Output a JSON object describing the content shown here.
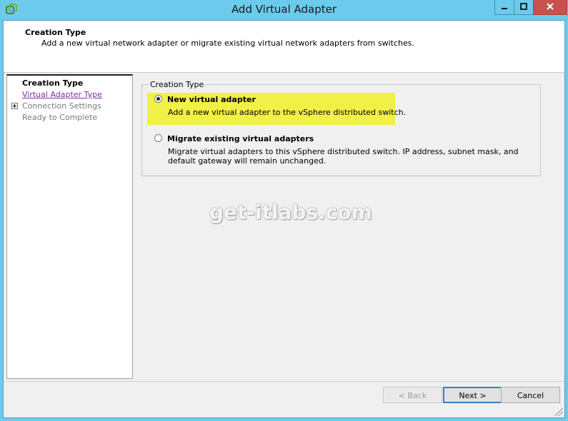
{
  "window": {
    "title": "Add Virtual Adapter",
    "minimize_glyph": "▬",
    "maximize_glyph": "▢",
    "close_glyph": "✕"
  },
  "header": {
    "title": "Creation Type",
    "description": "Add a new virtual network adapter or migrate existing virtual network adapters from switches."
  },
  "nav": {
    "items": [
      {
        "label": "Creation Type",
        "state": "current"
      },
      {
        "label": "Virtual Adapter Type",
        "state": "link"
      },
      {
        "label": "Connection Settings",
        "state": "disabled",
        "expandable": true
      },
      {
        "label": "Ready to Complete",
        "state": "disabled"
      }
    ]
  },
  "creation_type": {
    "group_label": "Creation Type",
    "options": [
      {
        "label": "New virtual adapter",
        "description": "Add a new virtual adapter to the vSphere distributed switch.",
        "selected": true
      },
      {
        "label": "Migrate existing virtual adapters",
        "description": "Migrate virtual adapters to this vSphere distributed switch. IP address, subnet mask, and default gateway will remain unchanged.",
        "selected": false
      }
    ]
  },
  "watermark": "get-itlabs.com",
  "buttons": {
    "back": "< Back",
    "next": "Next >",
    "cancel": "Cancel"
  },
  "colors": {
    "titlebar": "#6ccbec",
    "highlight": "#f0f047",
    "close_button": "#c7514c",
    "link": "#7d2ea2"
  }
}
